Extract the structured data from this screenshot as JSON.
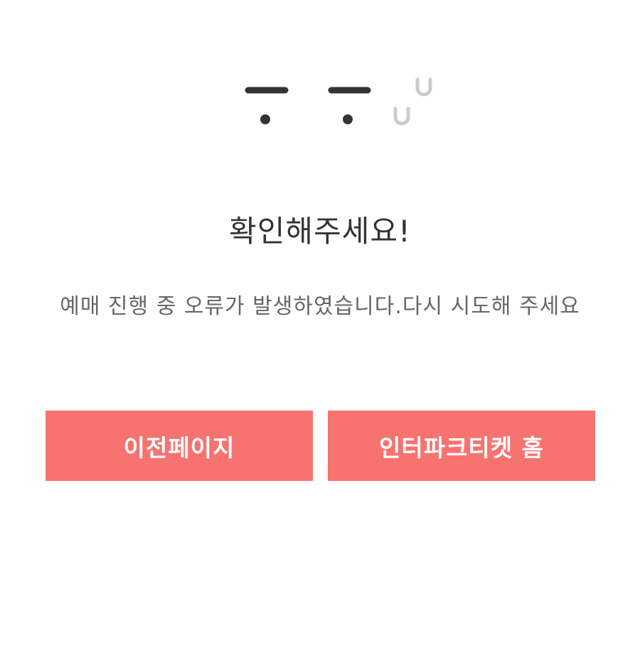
{
  "illustration": {
    "icon": "crying-face-icon",
    "colors": {
      "eyes": "#333333",
      "tears": "#cccccc"
    }
  },
  "error": {
    "title": "확인해주세요!",
    "message": "예매 진행 중 오류가 발생하였습니다.다시 시도해 주세요"
  },
  "actions": {
    "prev_label": "이전페이지",
    "home_label": "인터파크티켓 홈"
  },
  "colors": {
    "button_bg": "#f77370",
    "button_text": "#ffffff",
    "title_text": "#333333",
    "message_text": "#666666"
  }
}
